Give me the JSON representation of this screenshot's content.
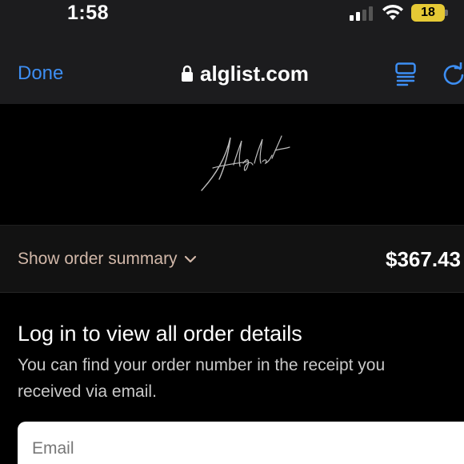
{
  "status_bar": {
    "time": "1:58",
    "battery_level": "18",
    "battery_color": "#e6c935",
    "signal_bars_active": 2,
    "signal_bars_total": 4
  },
  "browser": {
    "done_label": "Done",
    "url": "alglist.com",
    "accent_color": "#3d8ef3",
    "icons": [
      "lock-icon",
      "reader-mode-icon",
      "reload-icon"
    ]
  },
  "logo": {
    "text": "Alglist"
  },
  "order_summary": {
    "toggle_label": "Show order summary",
    "total": "$367.43",
    "label_color": "#d2b8a9"
  },
  "login": {
    "title": "Log in to view all order details",
    "description": "You can find your order number in the receipt you received via email.",
    "email_placeholder": "Email"
  }
}
